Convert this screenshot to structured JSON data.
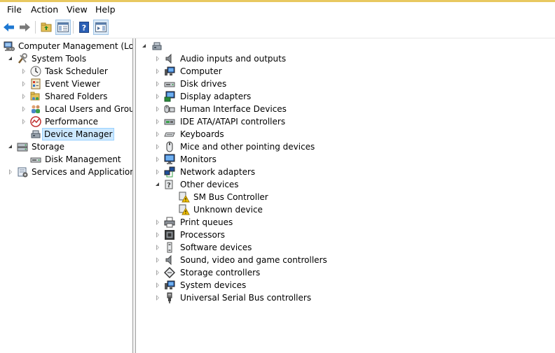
{
  "menu": [
    "File",
    "Action",
    "View",
    "Help"
  ],
  "left_tree": {
    "root": "Computer Management (Local",
    "system_tools": "System Tools",
    "task_scheduler": "Task Scheduler",
    "event_viewer": "Event Viewer",
    "shared_folders": "Shared Folders",
    "local_users": "Local Users and Groups",
    "performance": "Performance",
    "device_manager": "Device Manager",
    "storage": "Storage",
    "disk_management": "Disk Management",
    "services": "Services and Applications"
  },
  "device_tree": {
    "categories": [
      "Audio inputs and outputs",
      "Computer",
      "Disk drives",
      "Display adapters",
      "Human Interface Devices",
      "IDE ATA/ATAPI controllers",
      "Keyboards",
      "Mice and other pointing devices",
      "Monitors",
      "Network adapters",
      "Other devices",
      "Print queues",
      "Processors",
      "Software devices",
      "Sound, video and game controllers",
      "Storage controllers",
      "System devices",
      "Universal Serial Bus controllers"
    ],
    "other_devices_children": [
      "SM Bus Controller",
      "Unknown device"
    ]
  },
  "icons": {
    "toolbar": [
      "back-arrow-icon",
      "forward-arrow-icon",
      "up-folder-icon",
      "show-hide-console-tree-icon",
      "help-icon",
      "show-hide-action-pane-icon"
    ],
    "accent_colors": {
      "arrow": "#1e78d2",
      "help": "#2b5fb5",
      "warning": "#f5c400",
      "selection": "#cce8ff"
    }
  }
}
